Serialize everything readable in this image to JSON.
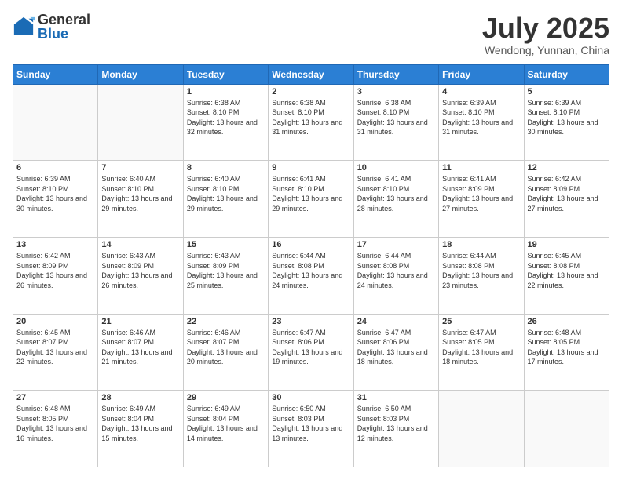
{
  "header": {
    "logo_general": "General",
    "logo_blue": "Blue",
    "month_year": "July 2025",
    "location": "Wendong, Yunnan, China"
  },
  "days_of_week": [
    "Sunday",
    "Monday",
    "Tuesday",
    "Wednesday",
    "Thursday",
    "Friday",
    "Saturday"
  ],
  "weeks": [
    [
      {
        "day": "",
        "info": ""
      },
      {
        "day": "",
        "info": ""
      },
      {
        "day": "1",
        "info": "Sunrise: 6:38 AM\nSunset: 8:10 PM\nDaylight: 13 hours and 32 minutes."
      },
      {
        "day": "2",
        "info": "Sunrise: 6:38 AM\nSunset: 8:10 PM\nDaylight: 13 hours and 31 minutes."
      },
      {
        "day": "3",
        "info": "Sunrise: 6:38 AM\nSunset: 8:10 PM\nDaylight: 13 hours and 31 minutes."
      },
      {
        "day": "4",
        "info": "Sunrise: 6:39 AM\nSunset: 8:10 PM\nDaylight: 13 hours and 31 minutes."
      },
      {
        "day": "5",
        "info": "Sunrise: 6:39 AM\nSunset: 8:10 PM\nDaylight: 13 hours and 30 minutes."
      }
    ],
    [
      {
        "day": "6",
        "info": "Sunrise: 6:39 AM\nSunset: 8:10 PM\nDaylight: 13 hours and 30 minutes."
      },
      {
        "day": "7",
        "info": "Sunrise: 6:40 AM\nSunset: 8:10 PM\nDaylight: 13 hours and 29 minutes."
      },
      {
        "day": "8",
        "info": "Sunrise: 6:40 AM\nSunset: 8:10 PM\nDaylight: 13 hours and 29 minutes."
      },
      {
        "day": "9",
        "info": "Sunrise: 6:41 AM\nSunset: 8:10 PM\nDaylight: 13 hours and 29 minutes."
      },
      {
        "day": "10",
        "info": "Sunrise: 6:41 AM\nSunset: 8:10 PM\nDaylight: 13 hours and 28 minutes."
      },
      {
        "day": "11",
        "info": "Sunrise: 6:41 AM\nSunset: 8:09 PM\nDaylight: 13 hours and 27 minutes."
      },
      {
        "day": "12",
        "info": "Sunrise: 6:42 AM\nSunset: 8:09 PM\nDaylight: 13 hours and 27 minutes."
      }
    ],
    [
      {
        "day": "13",
        "info": "Sunrise: 6:42 AM\nSunset: 8:09 PM\nDaylight: 13 hours and 26 minutes."
      },
      {
        "day": "14",
        "info": "Sunrise: 6:43 AM\nSunset: 8:09 PM\nDaylight: 13 hours and 26 minutes."
      },
      {
        "day": "15",
        "info": "Sunrise: 6:43 AM\nSunset: 8:09 PM\nDaylight: 13 hours and 25 minutes."
      },
      {
        "day": "16",
        "info": "Sunrise: 6:44 AM\nSunset: 8:08 PM\nDaylight: 13 hours and 24 minutes."
      },
      {
        "day": "17",
        "info": "Sunrise: 6:44 AM\nSunset: 8:08 PM\nDaylight: 13 hours and 24 minutes."
      },
      {
        "day": "18",
        "info": "Sunrise: 6:44 AM\nSunset: 8:08 PM\nDaylight: 13 hours and 23 minutes."
      },
      {
        "day": "19",
        "info": "Sunrise: 6:45 AM\nSunset: 8:08 PM\nDaylight: 13 hours and 22 minutes."
      }
    ],
    [
      {
        "day": "20",
        "info": "Sunrise: 6:45 AM\nSunset: 8:07 PM\nDaylight: 13 hours and 22 minutes."
      },
      {
        "day": "21",
        "info": "Sunrise: 6:46 AM\nSunset: 8:07 PM\nDaylight: 13 hours and 21 minutes."
      },
      {
        "day": "22",
        "info": "Sunrise: 6:46 AM\nSunset: 8:07 PM\nDaylight: 13 hours and 20 minutes."
      },
      {
        "day": "23",
        "info": "Sunrise: 6:47 AM\nSunset: 8:06 PM\nDaylight: 13 hours and 19 minutes."
      },
      {
        "day": "24",
        "info": "Sunrise: 6:47 AM\nSunset: 8:06 PM\nDaylight: 13 hours and 18 minutes."
      },
      {
        "day": "25",
        "info": "Sunrise: 6:47 AM\nSunset: 8:05 PM\nDaylight: 13 hours and 18 minutes."
      },
      {
        "day": "26",
        "info": "Sunrise: 6:48 AM\nSunset: 8:05 PM\nDaylight: 13 hours and 17 minutes."
      }
    ],
    [
      {
        "day": "27",
        "info": "Sunrise: 6:48 AM\nSunset: 8:05 PM\nDaylight: 13 hours and 16 minutes."
      },
      {
        "day": "28",
        "info": "Sunrise: 6:49 AM\nSunset: 8:04 PM\nDaylight: 13 hours and 15 minutes."
      },
      {
        "day": "29",
        "info": "Sunrise: 6:49 AM\nSunset: 8:04 PM\nDaylight: 13 hours and 14 minutes."
      },
      {
        "day": "30",
        "info": "Sunrise: 6:50 AM\nSunset: 8:03 PM\nDaylight: 13 hours and 13 minutes."
      },
      {
        "day": "31",
        "info": "Sunrise: 6:50 AM\nSunset: 8:03 PM\nDaylight: 13 hours and 12 minutes."
      },
      {
        "day": "",
        "info": ""
      },
      {
        "day": "",
        "info": ""
      }
    ]
  ]
}
